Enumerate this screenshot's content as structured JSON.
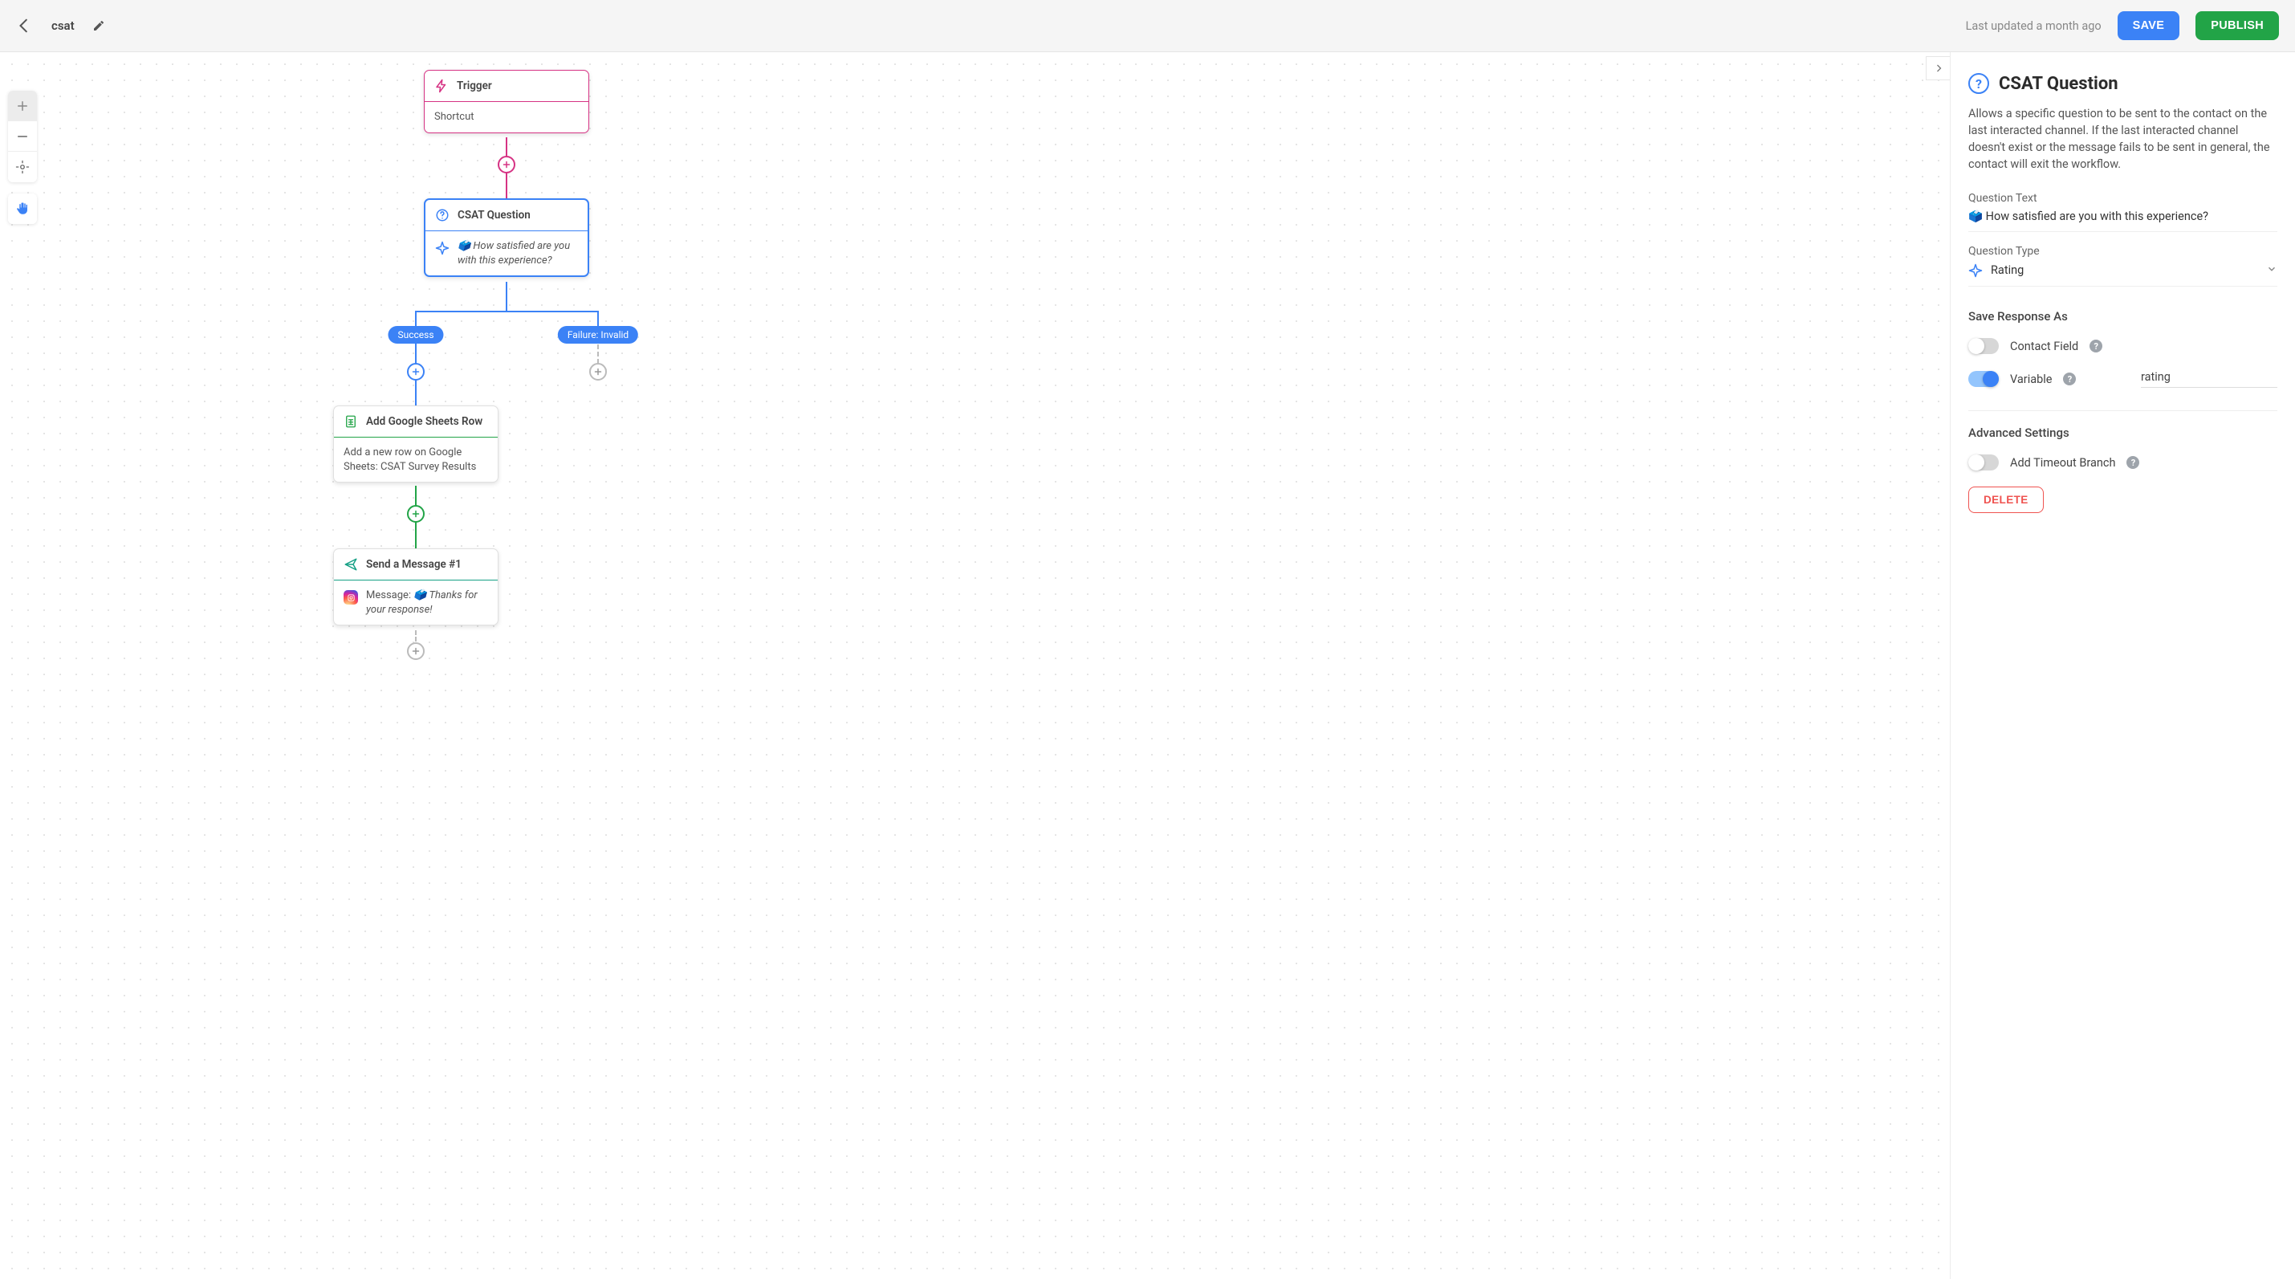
{
  "header": {
    "workflow_name": "csat",
    "last_updated": "Last updated a month ago",
    "save_label": "SAVE",
    "publish_label": "PUBLISH"
  },
  "nodes": {
    "trigger": {
      "title": "Trigger",
      "body": "Shortcut"
    },
    "csat": {
      "title": "CSAT Question",
      "body": "🗳️ How satisfied are you with this experience?"
    },
    "sheets": {
      "title": "Add Google Sheets Row",
      "body": "Add a new row on Google Sheets: CSAT Survey Results"
    },
    "message": {
      "title": "Send a Message #1",
      "body_prefix": "Message: ",
      "body": "🗳️ Thanks for your response!"
    }
  },
  "branches": {
    "success": "Success",
    "failure": "Failure: Invalid"
  },
  "panel": {
    "title": "CSAT Question",
    "description": "Allows a specific question to be sent to the contact on the last interacted channel. If the last interacted channel doesn't exist or the message fails to be sent in general, the contact will exit the workflow.",
    "question_text_label": "Question Text",
    "question_text_value": "🗳️ How satisfied are you with this experience?",
    "question_type_label": "Question Type",
    "question_type_value": "Rating",
    "save_response_label": "Save Response As",
    "contact_field_label": "Contact Field",
    "variable_label": "Variable",
    "variable_value": "rating",
    "advanced_label": "Advanced Settings",
    "timeout_label": "Add Timeout Branch",
    "delete_label": "DELETE"
  }
}
